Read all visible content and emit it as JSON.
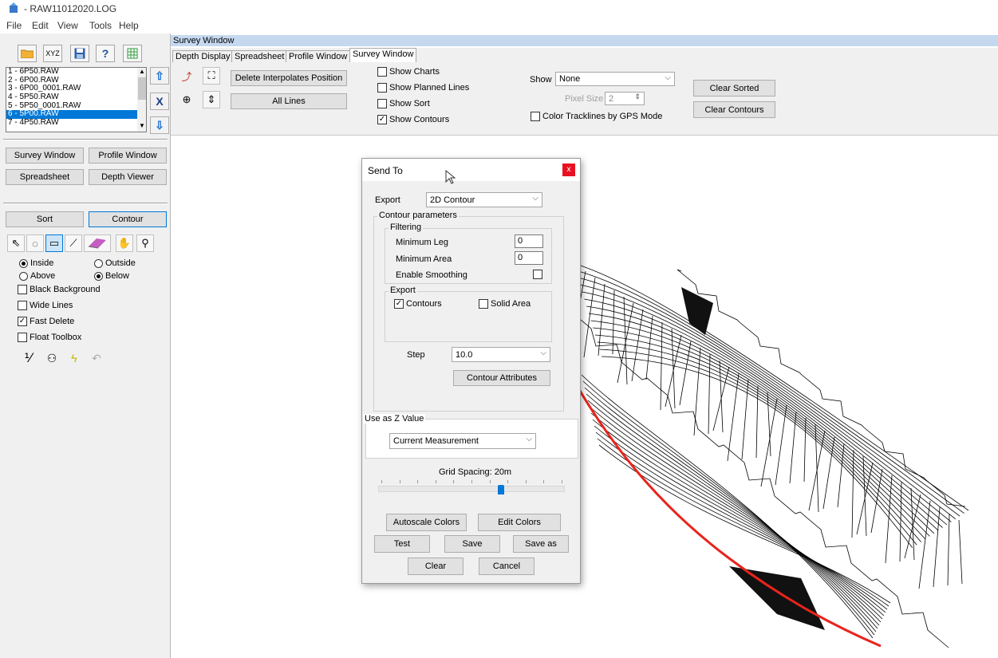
{
  "window": {
    "title": "- RAW11012020.LOG"
  },
  "menu": [
    "File",
    "Edit",
    "View",
    "Tools",
    "Help"
  ],
  "left_toolbar": {
    "xyz_label": "XYZ",
    "help_label": "?"
  },
  "file_list": {
    "items": [
      "1 - 6P50.RAW",
      "2 - 6P00.RAW",
      "3 - 6P00_0001.RAW",
      "4 - 5P50.RAW",
      "5 - 5P50_0001.RAW",
      "6 - 5P00.RAW",
      "7 - 4P50.RAW"
    ],
    "selected_index": 5
  },
  "nav_buttons": {
    "survey": "Survey Window",
    "profile": "Profile Window",
    "spreadsheet": "Spreadsheet",
    "depth_viewer": "Depth Viewer"
  },
  "mode_buttons": {
    "sort": "Sort",
    "contour": "Contour"
  },
  "options": {
    "inside": "Inside",
    "outside": "Outside",
    "above": "Above",
    "below": "Below",
    "black_background": "Black Background",
    "wide_lines": "Wide Lines",
    "fast_delete": "Fast Delete",
    "float_toolbox": "Float Toolbox"
  },
  "main": {
    "title": "Survey Window",
    "tabs": [
      "Depth Display",
      "Spreadsheet",
      "Profile Window",
      "Survey Window"
    ],
    "active_tab": 3,
    "buttons": {
      "delete_interpolates": "Delete Interpolates Position",
      "all_lines": "All Lines",
      "clear_sorted": "Clear Sorted",
      "clear_contours": "Clear Contours"
    },
    "checks": {
      "show_charts": "Show Charts",
      "show_planned": "Show Planned Lines",
      "show_sort": "Show Sort",
      "show_contours": "Show Contours",
      "color_tracklines": "Color Tracklines by GPS Mode"
    },
    "show_label": "Show",
    "show_value": "None",
    "pixel_size_label": "Pixel Size",
    "pixel_size_value": "2"
  },
  "dialog": {
    "title": "Send To",
    "close_glyph": "x",
    "export_label": "Export",
    "export_value": "2D Contour",
    "contour_parameters": "Contour parameters",
    "filtering": "Filtering",
    "minimum_leg_label": "Minimum Leg",
    "minimum_leg_value": "0",
    "minimum_area_label": "Minimum Area",
    "minimum_area_value": "0",
    "enable_smoothing": "Enable Smoothing",
    "export_group": "Export",
    "contours_label": "Contours",
    "solid_area_label": "Solid Area",
    "step_label": "Step",
    "step_value": "10.0",
    "contour_attributes": "Contour Attributes",
    "use_as_z": "Use as Z Value",
    "z_value": "Current Measurement",
    "grid_spacing": "Grid Spacing: 20m",
    "grid_slider_fraction": 0.66,
    "buttons": {
      "autoscale": "Autoscale Colors",
      "edit_colors": "Edit Colors",
      "test": "Test",
      "save": "Save",
      "save_as": "Save as",
      "clear": "Clear",
      "cancel": "Cancel"
    }
  },
  "colors": {
    "accent": "#0078d7",
    "trackline": "#e8241c",
    "title_bg": "#c5d8ef",
    "close_red": "#e81123"
  }
}
